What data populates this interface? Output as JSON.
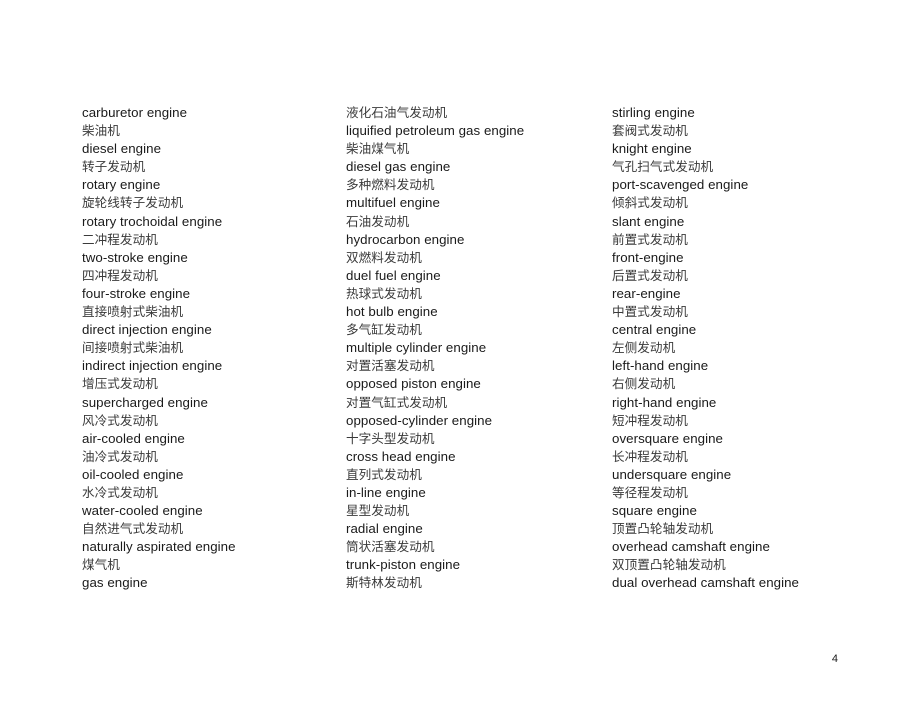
{
  "document": {
    "page_number": "4",
    "columns": [
      {
        "id": "column-1",
        "lines": [
          {
            "lang": "en",
            "text": "carburetor engine"
          },
          {
            "lang": "zh",
            "text": "柴油机"
          },
          {
            "lang": "en",
            "text": "diesel engine"
          },
          {
            "lang": "zh",
            "text": "转子发动机"
          },
          {
            "lang": "en",
            "text": "rotary engine"
          },
          {
            "lang": "zh",
            "text": "旋轮线转子发动机"
          },
          {
            "lang": "en",
            "text": "rotary trochoidal engine"
          },
          {
            "lang": "zh",
            "text": "二冲程发动机"
          },
          {
            "lang": "en",
            "text": "two-stroke engine"
          },
          {
            "lang": "zh",
            "text": "四冲程发动机"
          },
          {
            "lang": "en",
            "text": "four-stroke engine"
          },
          {
            "lang": "zh",
            "text": "直接喷射式柴油机"
          },
          {
            "lang": "en",
            "text": "direct injection engine"
          },
          {
            "lang": "zh",
            "text": "间接喷射式柴油机"
          },
          {
            "lang": "en",
            "text": "indirect injection engine"
          },
          {
            "lang": "zh",
            "text": "增压式发动机"
          },
          {
            "lang": "en",
            "text": "supercharged engine"
          },
          {
            "lang": "zh",
            "text": "风冷式发动机"
          },
          {
            "lang": "en",
            "text": "air-cooled engine"
          },
          {
            "lang": "zh",
            "text": "油冷式发动机"
          },
          {
            "lang": "en",
            "text": "oil-cooled engine"
          },
          {
            "lang": "zh",
            "text": "水冷式发动机"
          },
          {
            "lang": "en",
            "text": "water-cooled engine"
          },
          {
            "lang": "zh",
            "text": "自然进气式发动机"
          },
          {
            "lang": "en",
            "text": "naturally aspirated engine"
          },
          {
            "lang": "zh",
            "text": "煤气机"
          },
          {
            "lang": "en",
            "text": "gas engine"
          }
        ]
      },
      {
        "id": "column-2",
        "lines": [
          {
            "lang": "zh",
            "text": "液化石油气发动机"
          },
          {
            "lang": "en",
            "text": "liquified petroleum gas engine"
          },
          {
            "lang": "zh",
            "text": "柴油煤气机"
          },
          {
            "lang": "en",
            "text": "diesel gas engine"
          },
          {
            "lang": "zh",
            "text": "多种燃料发动机"
          },
          {
            "lang": "en",
            "text": "multifuel engine"
          },
          {
            "lang": "zh",
            "text": "石油发动机"
          },
          {
            "lang": "en",
            "text": "hydrocarbon engine"
          },
          {
            "lang": "zh",
            "text": "双燃料发动机"
          },
          {
            "lang": "en",
            "text": "duel fuel engine"
          },
          {
            "lang": "zh",
            "text": "热球式发动机"
          },
          {
            "lang": "en",
            "text": "hot bulb engine"
          },
          {
            "lang": "zh",
            "text": "多气缸发动机"
          },
          {
            "lang": "en",
            "text": "multiple cylinder engine"
          },
          {
            "lang": "zh",
            "text": "对置活塞发动机"
          },
          {
            "lang": "en",
            "text": "opposed piston engine"
          },
          {
            "lang": "zh",
            "text": "对置气缸式发动机"
          },
          {
            "lang": "en",
            "text": "opposed-cylinder engine"
          },
          {
            "lang": "zh",
            "text": "十字头型发动机"
          },
          {
            "lang": "en",
            "text": "cross head engine"
          },
          {
            "lang": "zh",
            "text": "直列式发动机"
          },
          {
            "lang": "en",
            "text": "in-line engine"
          },
          {
            "lang": "zh",
            "text": "星型发动机"
          },
          {
            "lang": "en",
            "text": "radial engine"
          },
          {
            "lang": "zh",
            "text": "筒状活塞发动机"
          },
          {
            "lang": "en",
            "text": "trunk-piston engine"
          },
          {
            "lang": "zh",
            "text": "斯特林发动机"
          }
        ]
      },
      {
        "id": "column-3",
        "lines": [
          {
            "lang": "en",
            "text": "stirling engine"
          },
          {
            "lang": "zh",
            "text": "套阀式发动机"
          },
          {
            "lang": "en",
            "text": "knight engine"
          },
          {
            "lang": "zh",
            "text": "气孔扫气式发动机"
          },
          {
            "lang": "en",
            "text": "port-scavenged engine"
          },
          {
            "lang": "zh",
            "text": "倾斜式发动机"
          },
          {
            "lang": "en",
            "text": "slant engine"
          },
          {
            "lang": "zh",
            "text": "前置式发动机"
          },
          {
            "lang": "en",
            "text": "front-engine"
          },
          {
            "lang": "zh",
            "text": "后置式发动机"
          },
          {
            "lang": "en",
            "text": "rear-engine"
          },
          {
            "lang": "zh",
            "text": "中置式发动机"
          },
          {
            "lang": "en",
            "text": "central engine"
          },
          {
            "lang": "zh",
            "text": "左侧发动机"
          },
          {
            "lang": "en",
            "text": "left-hand engine"
          },
          {
            "lang": "zh",
            "text": "右侧发动机"
          },
          {
            "lang": "en",
            "text": "right-hand engine"
          },
          {
            "lang": "zh",
            "text": "短冲程发动机"
          },
          {
            "lang": "en",
            "text": "oversquare engine"
          },
          {
            "lang": "zh",
            "text": "长冲程发动机"
          },
          {
            "lang": "en",
            "text": "undersquare engine"
          },
          {
            "lang": "zh",
            "text": "等径程发动机"
          },
          {
            "lang": "en",
            "text": "square engine"
          },
          {
            "lang": "zh",
            "text": "顶置凸轮轴发动机"
          },
          {
            "lang": "en",
            "text": "overhead camshaft engine"
          },
          {
            "lang": "zh",
            "text": "双顶置凸轮轴发动机"
          },
          {
            "lang": "en",
            "text": "dual overhead camshaft engine"
          }
        ]
      }
    ]
  }
}
